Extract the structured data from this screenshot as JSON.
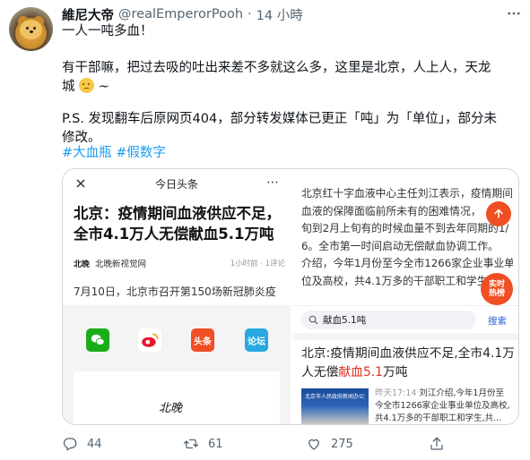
{
  "tweet": {
    "display_name": "維尼大帝",
    "handle": "@realEmperorPooh",
    "separator": "·",
    "time": "14 小時",
    "more_icon": "more-horizontal-icon",
    "lines": [
      "一人一吨多血！",
      "有干部嘛，把过去吸的吐出来差不多就这么多，这里是北京，人上人，天龙",
      "城",
      "~",
      "P.S. 发现翻车后原网页404，部分转发媒体已更正「吨」为「单位」，部分未",
      "修改。"
    ],
    "hashtags": [
      "#大血瓶",
      "#假数字"
    ]
  },
  "left_image": {
    "nav_title": "今日头条",
    "headline_1": "北京：疫情期间血液供应不足，",
    "headline_2": "全市4.1万人无偿献血5.1万吨",
    "source_logo": "北晚",
    "source_name": "北晚新视觉网",
    "source_meta": "1小时前 · 1评论",
    "body": "7月10日，北京市召开第150场新冠肺炎疫",
    "share": [
      "头条",
      "论坛"
    ],
    "card_logo": "北晚"
  },
  "right_image": {
    "body_lines": [
      "北京红十字血液中心主任刘江表示，疫情期间",
      "血液的保障面临前所未有的困难情况，",
      "旬到2月上旬有的时候血量不到去年同期的1/",
      "6。全市第一时间启动无偿献血协调工作。",
      "介绍，今年1月份至今全市1266家企业事业单",
      "位及高校，共4.1万多的干部职工和学生"
    ],
    "fab_label": "实时\n热榜",
    "search_value": "献血5.1吨",
    "search_button": "搜索",
    "headline_a": "北京:疫情期间血液供应不足,全市4.1万",
    "headline_b_pre": "人无偿",
    "headline_b_red": "献血5.1",
    "headline_b_post": "万吨",
    "thumb_title": "北京市人民政府新闻办公室",
    "meta_time": "昨天17:14",
    "meta_lines": [
      " 刘江介绍,今年1月份至",
      "今全市1266家企业事业单位及高校,",
      "共4.1万多的干部职工和学生,共..."
    ]
  },
  "actions": {
    "reply_count": "44",
    "retweet_count": "61",
    "like_count": "275"
  },
  "colors": {
    "link": "#1d9bf0",
    "secondary": "#536471",
    "accent_red": "#e0321e"
  }
}
